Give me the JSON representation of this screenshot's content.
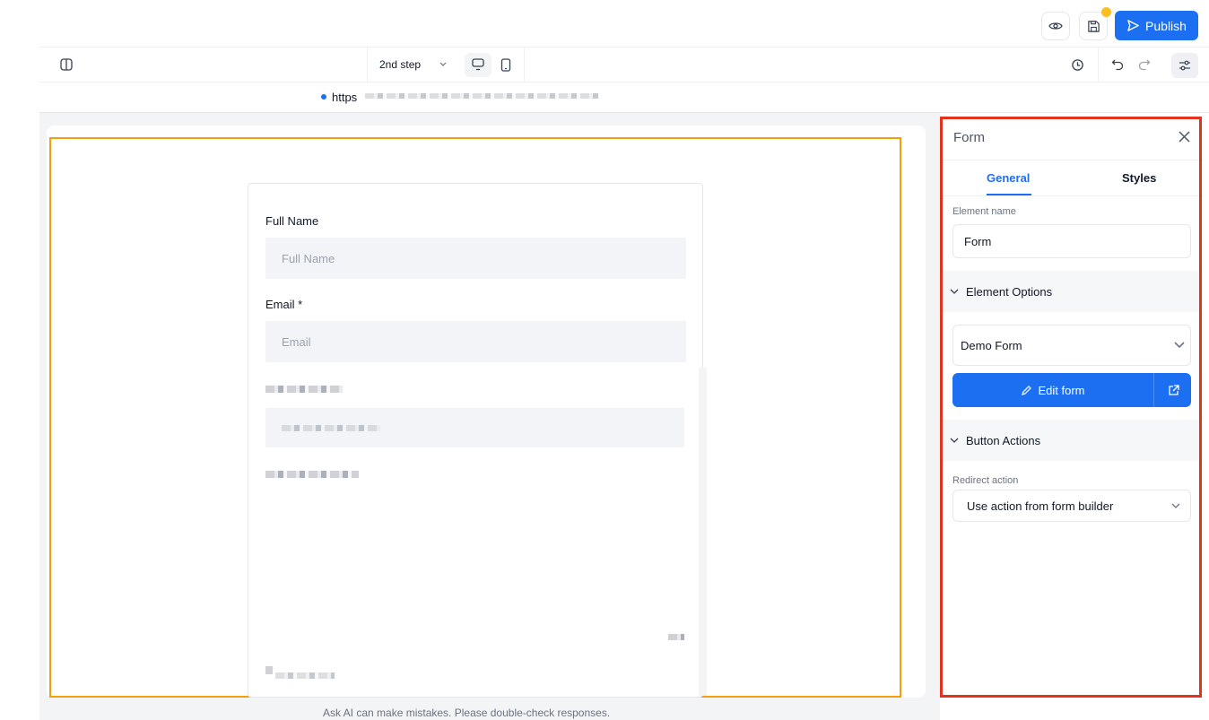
{
  "header": {
    "publish_label": "Publish",
    "icons": [
      "eye-icon",
      "save-icon",
      "send-icon"
    ]
  },
  "toolbar": {
    "step_label": "2nd step",
    "icons": [
      "sidebar-toggle-icon",
      "chevron-down-icon",
      "desktop-icon",
      "mobile-icon",
      "history-icon",
      "undo-icon",
      "redo-icon",
      "settings-sliders-icon"
    ]
  },
  "urlbar": {
    "url_text": "https"
  },
  "form_preview": {
    "fields": [
      {
        "label": "Full Name",
        "placeholder": "Full Name"
      },
      {
        "label": "Email *",
        "placeholder": "Email"
      }
    ]
  },
  "footer": {
    "disclaimer": "Ask AI can make mistakes. Please double-check responses."
  },
  "panel": {
    "title": "Form",
    "tabs": [
      {
        "label": "General",
        "active": true
      },
      {
        "label": "Styles",
        "active": false
      }
    ],
    "element_name_label": "Element name",
    "element_name_value": "Form",
    "element_options_heading": "Element Options",
    "form_select_value": "Demo Form",
    "edit_form_label": "Edit form",
    "button_actions_heading": "Button Actions",
    "redirect_label": "Redirect action",
    "redirect_value": "Use action from form builder"
  },
  "colors": {
    "accent": "#1d6ff2",
    "selection_frame": "#f59e0b",
    "panel_highlight": "#e0341e"
  }
}
